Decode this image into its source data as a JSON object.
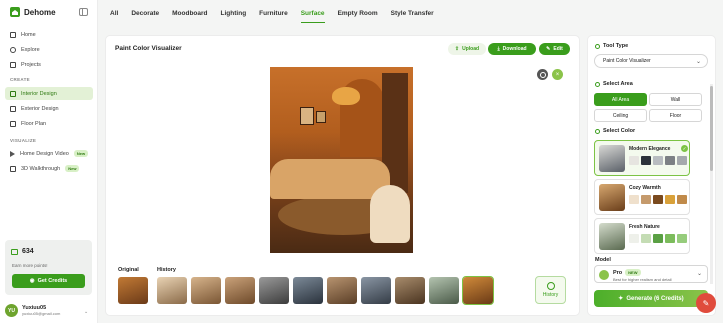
{
  "app": {
    "name": "Dehome"
  },
  "sidebar": {
    "items": [
      {
        "label": "Home"
      },
      {
        "label": "Explore"
      },
      {
        "label": "Projects"
      }
    ],
    "create_label": "CREATE",
    "create_items": [
      {
        "label": "Interior Design"
      },
      {
        "label": "Exterior Design"
      },
      {
        "label": "Floor Plan"
      }
    ],
    "visualize_label": "VISUALIZE",
    "visualize_items": [
      {
        "label": "Home Design Video",
        "badge": "New"
      },
      {
        "label": "3D Walkthrough",
        "badge": "New"
      }
    ],
    "credits": {
      "count": "634",
      "subtitle": "Earn more points!",
      "button": "Get Credits"
    },
    "user": {
      "initials": "YU",
      "name": "Yuxiuu05",
      "email": "yuxiuu05@gmail.com"
    }
  },
  "tabs": [
    "All",
    "Decorate",
    "Moodboard",
    "Lighting",
    "Furniture",
    "Surface",
    "Empty Room",
    "Style Transfer"
  ],
  "active_tab": "Surface",
  "main": {
    "title": "Paint Color Visualizer",
    "upload": "Upload",
    "download": "Download",
    "edit": "Edit",
    "original_label": "Original",
    "history_label": "History",
    "history_button": "History"
  },
  "panel": {
    "tool_type_label": "Tool Type",
    "tool_type_value": "Paint Color Visualizer",
    "select_area_label": "Select Area",
    "areas": [
      "All Area",
      "Wall",
      "Ceiling",
      "Floor"
    ],
    "active_area": "All Area",
    "select_color_label": "Select Color",
    "colors": [
      {
        "name": "Modern Elegance",
        "swatches": [
          "#e6e4e0",
          "#2c323a",
          "#b8bcc0",
          "#7c8084",
          "#a4a8ac"
        ],
        "selected": true
      },
      {
        "name": "Cozy Warmth",
        "swatches": [
          "#efe0cc",
          "#c59a6c",
          "#7a4a1e",
          "#d9a13a",
          "#c08a4a"
        ],
        "selected": false
      },
      {
        "name": "Fresh Nature",
        "swatches": [
          "#eef0ea",
          "#c4dcb4",
          "#5aa044",
          "#7cbc5c",
          "#96cc7c"
        ],
        "selected": false
      }
    ],
    "model_label": "Model",
    "model_name": "Pro",
    "model_badge": "NEW",
    "model_desc": "Best for higher realism and detail",
    "generate": "Generate (6 Credits)"
  },
  "colors": {
    "accent": "#3a9d1c",
    "accent_light": "#8bc34a"
  }
}
